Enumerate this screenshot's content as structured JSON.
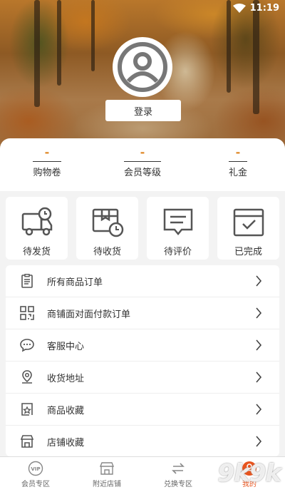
{
  "status_bar": {
    "time": "11:19"
  },
  "profile": {
    "login_label": "登录"
  },
  "stats": [
    {
      "value": "-",
      "label": "购物卷"
    },
    {
      "value": "-",
      "label": "会员等级"
    },
    {
      "value": "-",
      "label": "礼金"
    }
  ],
  "orders": [
    {
      "label": "待发货",
      "icon": "truck-icon"
    },
    {
      "label": "待收货",
      "icon": "package-clock-icon"
    },
    {
      "label": "待评价",
      "icon": "comment-icon"
    },
    {
      "label": "已完成",
      "icon": "calendar-check-icon"
    }
  ],
  "menu": [
    {
      "label": "所有商品订单",
      "icon": "clipboard-icon"
    },
    {
      "label": "商铺面对面付款订单",
      "icon": "qr-code-icon"
    },
    {
      "label": "客服中心",
      "icon": "chat-icon"
    },
    {
      "label": "收货地址",
      "icon": "location-icon"
    },
    {
      "label": "商品收藏",
      "icon": "favorite-goods-icon"
    },
    {
      "label": "店铺收藏",
      "icon": "store-icon"
    }
  ],
  "tabs": [
    {
      "label": "会员专区",
      "icon": "vip-icon",
      "active": false
    },
    {
      "label": "附近店铺",
      "icon": "nearby-store-icon",
      "active": false
    },
    {
      "label": "兑换专区",
      "icon": "exchange-icon",
      "active": false
    },
    {
      "label": "我的",
      "icon": "profile-icon",
      "active": true
    }
  ],
  "colors": {
    "accent": "#e08a2a",
    "active_tab": "#e8541e",
    "icon_gray": "#555555"
  },
  "watermark": "9k9k"
}
